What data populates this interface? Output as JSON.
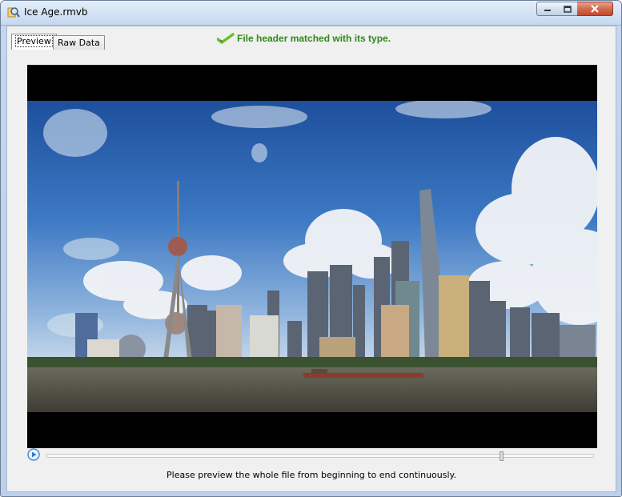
{
  "window": {
    "title": "Ice Age.rmvb",
    "controls": {
      "minimize_icon": "minimize-icon",
      "maximize_icon": "maximize-icon",
      "close_icon": "close-icon"
    }
  },
  "tabs": [
    {
      "label": "Preview",
      "active": true
    },
    {
      "label": "Raw Data",
      "active": false
    }
  ],
  "status": {
    "icon": "checkmark-icon",
    "text": "File header matched with its type.",
    "color": "#2f8a1a"
  },
  "player": {
    "play_icon": "play-icon",
    "progress": 0.83
  },
  "hint": "Please preview the whole file from beginning to end continuously."
}
